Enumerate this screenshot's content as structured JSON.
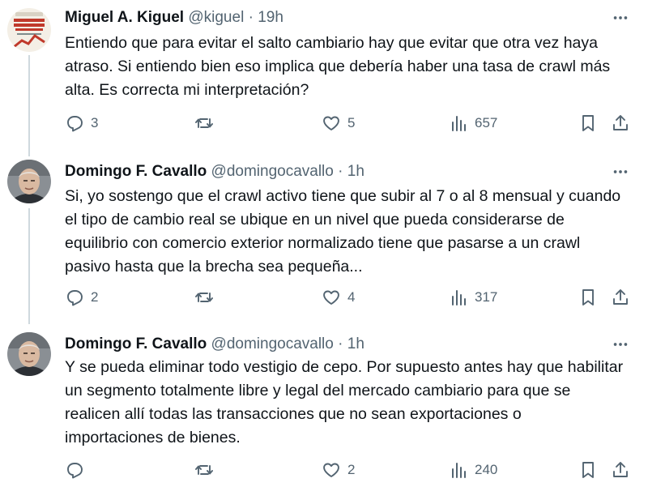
{
  "tweets": [
    {
      "name": "Miguel A. Kiguel",
      "handle": "@kiguel",
      "time": "19h",
      "text": "Entiendo que para evitar el salto cambiario hay que evitar que otra vez haya atraso.  Si entiendo bien eso implica que debería haber una tasa de crawl más alta.  Es correcta mi interpretación?",
      "replies": "3",
      "retweets": "",
      "likes": "5",
      "views": "657",
      "avatar_book_title": "Las crisis económicas argentinas"
    },
    {
      "name": "Domingo F. Cavallo",
      "handle": "@domingocavallo",
      "time": "1h",
      "text": "Si, yo sostengo que el crawl activo tiene que subir al 7 o al 8 mensual y cuando el tipo de cambio real se ubique en un nivel que pueda considerarse de equilibrio con comercio exterior normalizado tiene que pasarse a un crawl pasivo hasta que la brecha sea pequeña...",
      "replies": "2",
      "retweets": "",
      "likes": "4",
      "views": "317"
    },
    {
      "name": "Domingo F. Cavallo",
      "handle": "@domingocavallo",
      "time": "1h",
      "text": "Y se pueda eliminar todo vestigio de cepo. Por supuesto antes hay que habilitar un segmento totalmente libre y legal del mercado cambiario para que se realicen allí todas las transacciones que no sean exportaciones o importaciones de bienes.",
      "replies": "",
      "retweets": "",
      "likes": "2",
      "views": "240"
    }
  ],
  "separator": "·",
  "colors": {
    "text": "#0f1419",
    "muted": "#536471",
    "thread_line": "#cfd9de"
  },
  "icons": [
    "more-icon",
    "reply-icon",
    "retweet-icon",
    "like-icon",
    "views-icon",
    "bookmark-icon",
    "share-icon"
  ]
}
